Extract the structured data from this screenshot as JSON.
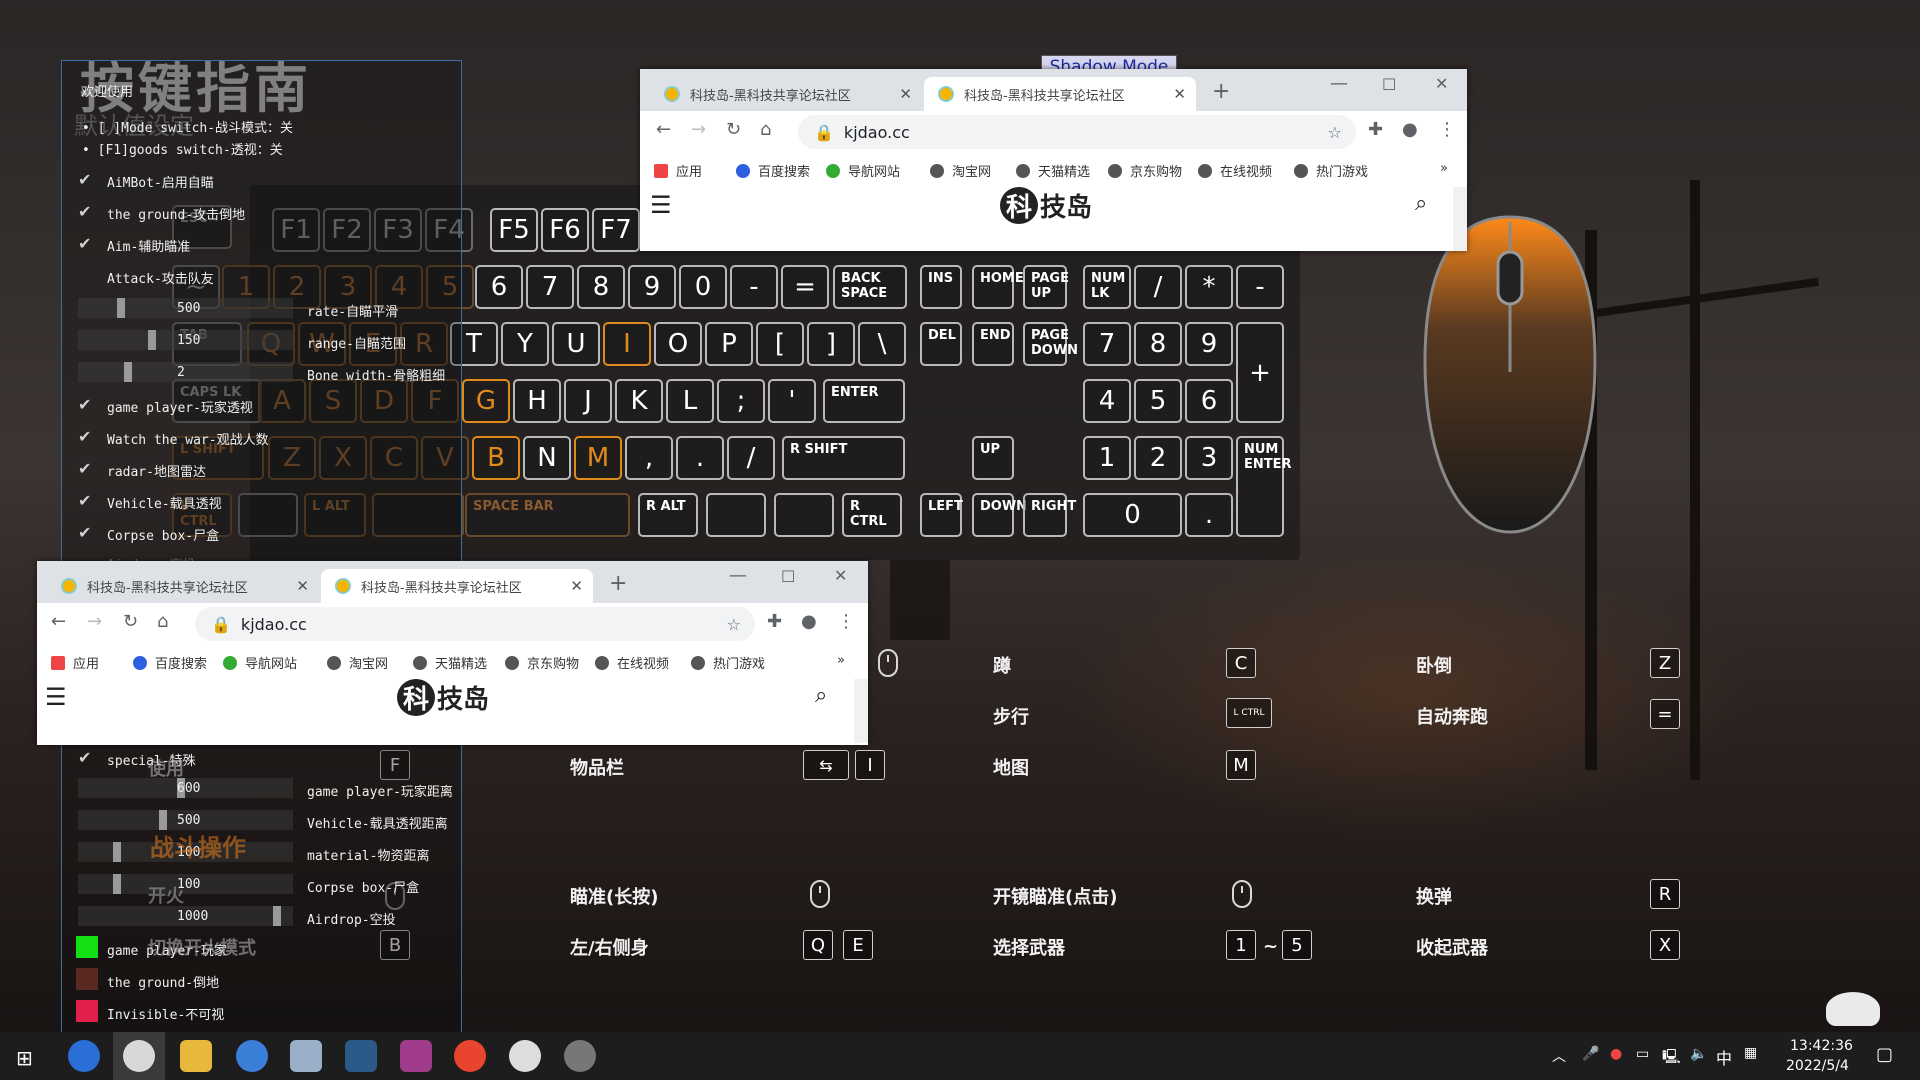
{
  "overlay": {
    "title": "按键指南",
    "subtitle": "默认值设定",
    "shadow_mode": "Shadow Mode",
    "combat_section": "战斗操作",
    "fire": "开火",
    "fire_mode": "切换开火模式",
    "use": "使用",
    "use_key": "F",
    "fire_mode_key": "B"
  },
  "menu": {
    "welcome": "欢迎使用",
    "bullets": [
      "[ ]Mode switch-战斗模式：关",
      "[F1]goods switch-透视：关"
    ],
    "checks": [
      "AiMBot-启用自瞄",
      "the ground-攻击倒地",
      "Aim-辅助瞄准",
      "Attack-攻击队友"
    ],
    "sliders1": [
      {
        "value": "500",
        "label": "rate-自瞄平滑",
        "level": 0.19
      },
      {
        "value": "150",
        "label": "range-自瞄范围",
        "level": 0.34
      },
      {
        "value": "2",
        "label": "Bone width-骨骼粗细",
        "level": 0.22
      }
    ],
    "checks2": [
      "game player-玩家透视",
      "Watch the war-观战人数",
      "radar-地图雷达",
      "Vehicle-载具透视",
      "Corpse box-尸盒"
    ],
    "partial": "Airdrop-空投",
    "special": "special-特殊",
    "sliders2": [
      {
        "value": "600",
        "label": "game player-玩家距离",
        "level": 0.48
      },
      {
        "value": "500",
        "label": "Vehicle-载具透视距离",
        "level": 0.39
      },
      {
        "value": "100",
        "label": "material-物资距离",
        "level": 0.17
      },
      {
        "value": "100",
        "label": "Corpse box-尸盒",
        "level": 0.17
      },
      {
        "value": "1000",
        "label": "Airdrop-空投",
        "level": 0.94
      }
    ],
    "colors": [
      {
        "label": "game player-玩家",
        "color": "#12e012"
      },
      {
        "label": "the ground-倒地",
        "color": "#5a2a22"
      },
      {
        "label": "Invisible-不可视",
        "color": "#e0204a"
      }
    ]
  },
  "keyboard": {
    "row_fn": [
      "ESC",
      "F1",
      "F2",
      "F3",
      "F4",
      "F5",
      "F6",
      "F7"
    ],
    "row_num": [
      "~",
      "1",
      "2",
      "3",
      "4",
      "5",
      "6",
      "7",
      "8",
      "9",
      "0",
      "-",
      "=",
      "BACK SPACE"
    ],
    "row_q": [
      "TAB",
      "Q",
      "W",
      "E",
      "R",
      "T",
      "Y",
      "U",
      "I",
      "O",
      "P",
      "[",
      "]",
      "\\"
    ],
    "row_a": [
      "CAPS LK",
      "A",
      "S",
      "D",
      "F",
      "G",
      "H",
      "J",
      "K",
      "L",
      ";",
      "'",
      "ENTER"
    ],
    "row_z": [
      "L SHIFT",
      "Z",
      "X",
      "C",
      "V",
      "B",
      "N",
      "M",
      ",",
      ".",
      "/",
      "R SHIFT"
    ],
    "row_sp": [
      "L CTRL",
      "L ALT",
      "SPACE BAR",
      "R ALT",
      "R CTRL"
    ],
    "nav": [
      "INS",
      "HOME",
      "PAGE UP",
      "DEL",
      "END",
      "PAGE DOWN",
      "UP",
      "LEFT",
      "DOWN",
      "RIGHT"
    ],
    "numpad": [
      "NUM LK",
      "/",
      "*",
      "-",
      "7",
      "8",
      "9",
      "+",
      "4",
      "5",
      "6",
      "1",
      "2",
      "3",
      "NUM ENTER",
      "0",
      "."
    ]
  },
  "browser1": {
    "tab1": "科技岛-黑科技共享论坛社区",
    "tab2": "科技岛-黑科技共享论坛社区",
    "url": "kjdao.cc",
    "bookmarks": [
      "应用",
      "百度搜索",
      "导航网站",
      "淘宝网",
      "天猫精选",
      "京东购物",
      "在线视频",
      "热门游戏"
    ],
    "more": "»",
    "logo_char": "科",
    "logo_rest": "技岛"
  },
  "browser2": {
    "tab1": "科技岛-黑科技共享论坛社区",
    "tab2": "科技岛-黑科技共享论坛社区",
    "url": "kjdao.cc",
    "bookmarks": [
      "应用",
      "百度搜索",
      "导航网站",
      "淘宝网",
      "天猫精选",
      "京东购物",
      "在线视频",
      "热门游戏"
    ],
    "more": "»",
    "logo_char": "科",
    "logo_rest": "技岛"
  },
  "actions": {
    "crouch": "蹲",
    "crouch_key": "C",
    "prone": "卧倒",
    "prone_key": "Z",
    "walk": "步行",
    "walk_key": "L CTRL",
    "autorun": "自动奔跑",
    "autorun_key": "=",
    "inventory": "物品栏",
    "inventory_key": "I",
    "map": "地图",
    "map_key": "M",
    "aim_hold": "瞄准(长按)",
    "scope_click": "开镜瞄准(点击)",
    "reload": "换弹",
    "reload_key": "R",
    "lean": "左/右侧身",
    "lean_q": "Q",
    "lean_e": "E",
    "select_weapon": "选择武器",
    "sel_from": "1",
    "sel_tilde": "~",
    "sel_to": "5",
    "holster": "收起武器",
    "holster_key": "X"
  },
  "taskbar": {
    "time": "13:42:36",
    "date": "2022/5/4",
    "ime": "中"
  }
}
